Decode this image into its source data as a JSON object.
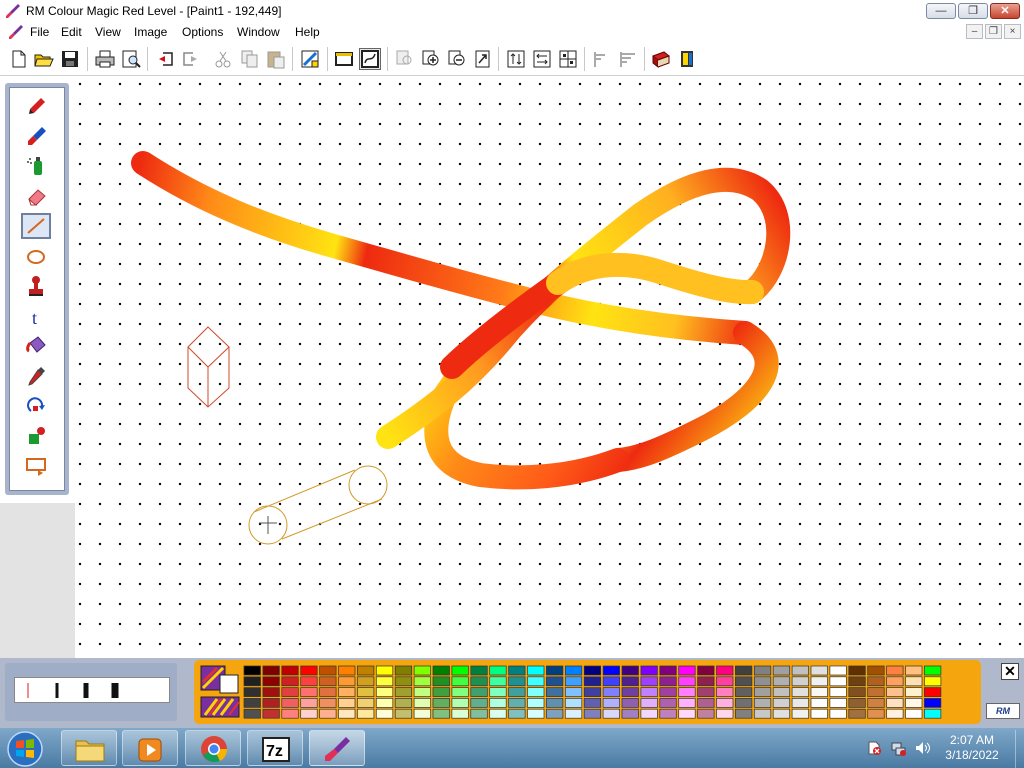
{
  "window": {
    "title": "RM Colour Magic  Red Level  - [Paint1 - 192,449]",
    "minimize": "—",
    "restore": "❐",
    "close": "✕"
  },
  "menu": [
    "File",
    "Edit",
    "View",
    "Image",
    "Options",
    "Window",
    "Help"
  ],
  "mdi_buttons": [
    "–",
    "❐",
    "×"
  ],
  "toolbar": [
    "new-icon",
    "open-icon",
    "save-icon",
    "print-icon",
    "print-preview-icon",
    "undo-icon",
    "redo-icon",
    "cut-icon",
    "copy-icon",
    "paste-icon",
    "select-all-icon",
    "rectangle-select-icon",
    "freehand-select-icon",
    "zoom-icon",
    "zoom-in-icon",
    "zoom-out-icon",
    "zoom-fit-icon",
    "mirror-icon",
    "flip-icon",
    "grid-icon",
    "effect-1-icon",
    "effect-2-icon",
    "book-icon",
    "exit-icon"
  ],
  "tools": [
    "pencil-icon",
    "paintbrush-icon",
    "spraycan-icon",
    "eraser-icon",
    "line-icon",
    "ellipse-icon",
    "stamp-icon",
    "text-icon",
    "fill-icon",
    "eyedropper-icon",
    "rotate-icon",
    "shapes-icon",
    "frame-icon"
  ],
  "selected_tool": "line-icon",
  "line_widths": [
    1,
    3,
    5,
    7
  ],
  "palette_close": "✕",
  "logo_text": "RM",
  "clock": {
    "time": "2:07 AM",
    "date": "3/18/2022"
  },
  "colors": {
    "palette_bg": "#f5a50d",
    "stroke_red": "#ee2a10",
    "stroke_orange": "#ff8a18",
    "stroke_yellow": "#ffe312",
    "shape_outline": "#d2691e"
  },
  "palette_colors": [
    [
      "#000000",
      "#800000",
      "#c00000",
      "#ff0000",
      "#c05000",
      "#ff8000",
      "#c08000",
      "#ffff00",
      "#808000",
      "#80ff00",
      "#008000",
      "#00ff00",
      "#008040",
      "#00ff80",
      "#008080",
      "#00ffff",
      "#004080",
      "#0080ff",
      "#000080",
      "#0000ff",
      "#400080",
      "#8000ff",
      "#800080",
      "#ff00ff",
      "#800040",
      "#ff0080",
      "#404040",
      "#808080",
      "#a0a0a0",
      "#c0c0c0",
      "#e0e0e0",
      "#ffffff",
      "#603000",
      "#a05000",
      "#ff8040",
      "#ffc080",
      "#00ff00"
    ],
    [
      "#202020",
      "#900000",
      "#d02020",
      "#ff4040",
      "#d06020",
      "#ff9933",
      "#d0a020",
      "#ffff40",
      "#909010",
      "#a0ff40",
      "#209020",
      "#40ff40",
      "#209050",
      "#40ffa0",
      "#209090",
      "#40ffff",
      "#205090",
      "#40a0ff",
      "#202090",
      "#4040ff",
      "#502090",
      "#a040ff",
      "#902090",
      "#ff40ff",
      "#902050",
      "#ff40a0",
      "#505050",
      "#909090",
      "#b0b0b0",
      "#d0d0d0",
      "#f0f0f0",
      "#ffffff",
      "#704010",
      "#b06020",
      "#ffa060",
      "#ffe0b0",
      "#ffff00"
    ],
    [
      "#303030",
      "#a01010",
      "#e04040",
      "#ff7070",
      "#e07040",
      "#ffb060",
      "#e0c040",
      "#ffff80",
      "#a0a030",
      "#c0ff80",
      "#40a040",
      "#80ff80",
      "#40a070",
      "#80ffc0",
      "#40a0a0",
      "#80ffff",
      "#4070a0",
      "#80c0ff",
      "#4040a0",
      "#8080ff",
      "#7040a0",
      "#c080ff",
      "#a040a0",
      "#ff80ff",
      "#a04070",
      "#ff80c0",
      "#606060",
      "#a0a0a0",
      "#c0c0c0",
      "#e0e0e0",
      "#f8f8f8",
      "#ffffff",
      "#805020",
      "#c07030",
      "#ffc090",
      "#fff0d0",
      "#ff0000"
    ],
    [
      "#404040",
      "#b02020",
      "#f06060",
      "#ffa0a0",
      "#f09060",
      "#ffd090",
      "#f0d070",
      "#ffffb0",
      "#b0b050",
      "#e0ffb0",
      "#60b060",
      "#b0ffb0",
      "#60b090",
      "#b0ffe0",
      "#60b0b0",
      "#b0ffff",
      "#6090b0",
      "#b0e0ff",
      "#6060b0",
      "#b0b0ff",
      "#9060b0",
      "#e0b0ff",
      "#b060b0",
      "#ffb0ff",
      "#b06090",
      "#ffb0e0",
      "#707070",
      "#b0b0b0",
      "#d0d0d0",
      "#e8e8e8",
      "#fcfcfc",
      "#ffffff",
      "#906030",
      "#d08040",
      "#ffe0c0",
      "#fff8e8",
      "#0000ff"
    ],
    [
      "#505050",
      "#c03030",
      "#ff8080",
      "#ffd0d0",
      "#ffb090",
      "#ffe8c0",
      "#ffe8a0",
      "#ffffd8",
      "#c0c070",
      "#f0ffd8",
      "#80c080",
      "#d8ffd8",
      "#80c0a0",
      "#d8fff0",
      "#80c0c0",
      "#d8ffff",
      "#80a0c0",
      "#d8f0ff",
      "#8080c0",
      "#d8d8ff",
      "#a080c0",
      "#f0d8ff",
      "#c080c0",
      "#ffd8ff",
      "#c080a0",
      "#ffd8f0",
      "#808080",
      "#c8c8c8",
      "#e0e0e0",
      "#f0f0f0",
      "#ffffff",
      "#ffffff",
      "#a07040",
      "#e09050",
      "#fff0e0",
      "#ffffff",
      "#00ffff"
    ]
  ]
}
